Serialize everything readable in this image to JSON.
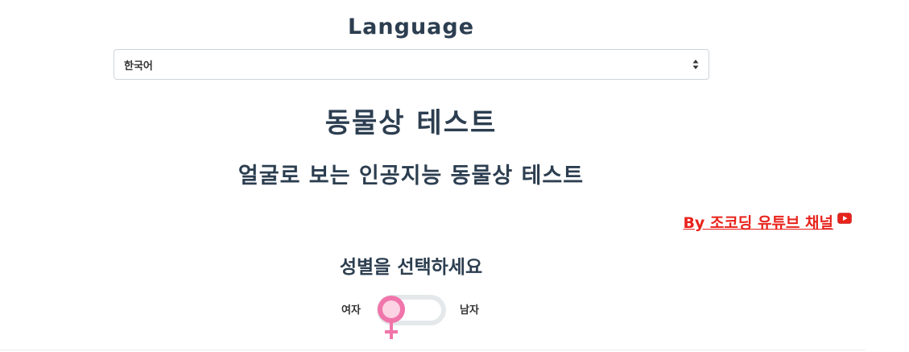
{
  "language": {
    "title": "Language",
    "select": {
      "selected": "한국어"
    }
  },
  "main": {
    "title": "동물상 테스트",
    "subtitle": "얼굴로 보는 인공지능 동물상 테스트"
  },
  "link": {
    "label": "By 조코딩 유튜브 채널",
    "icon": "youtube-icon",
    "color": "#e8231c"
  },
  "gender": {
    "prompt": "성별을 선택하세요",
    "female_label": "여자",
    "male_label": "남자",
    "selected": "여자",
    "accent": "#f075aa"
  }
}
